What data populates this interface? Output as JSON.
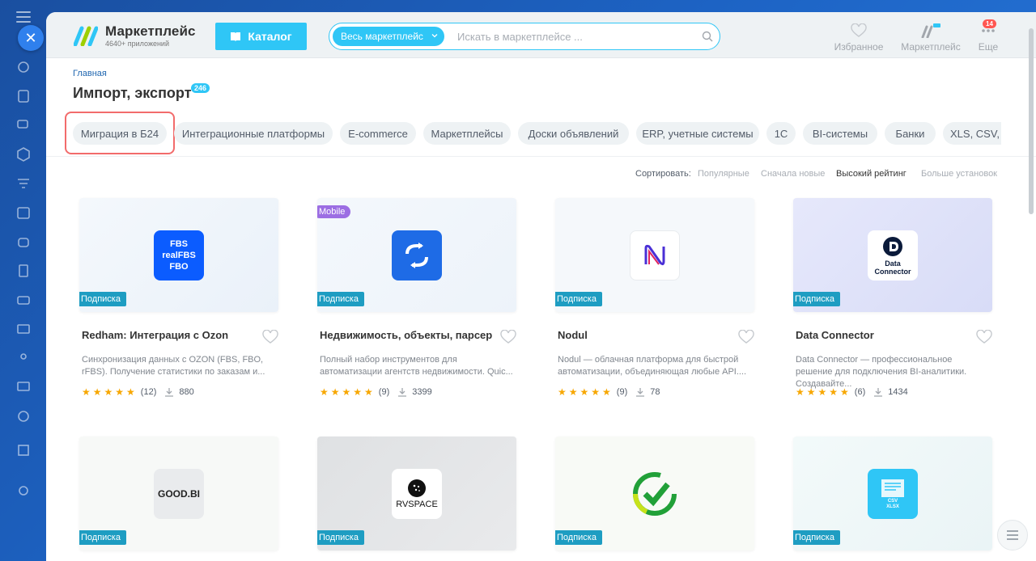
{
  "header": {
    "brand_title": "Маркетплейс",
    "brand_subtitle": "4640+ приложений",
    "catalog_label": "Каталог",
    "search_scope": "Весь маркетплейс",
    "search_placeholder": "Искать в маркетплейсе ...",
    "favorites_label": "Избранное",
    "marketplace_label": "Маркетплейс",
    "more_label": "Еще",
    "more_badge": "14"
  },
  "breadcrumb": "Главная",
  "page_title": "Импорт, экспорт",
  "app_count": "246",
  "chips": [
    {
      "label": "Миграция в Б24"
    },
    {
      "label": "Интеграционные платформы"
    },
    {
      "label": "E-commerce"
    },
    {
      "label": "Маркетплейсы"
    },
    {
      "label": "Доски объявлений"
    },
    {
      "label": "ERP, учетные системы"
    },
    {
      "label": "1С"
    },
    {
      "label": "BI-системы"
    },
    {
      "label": "Банки"
    },
    {
      "label": "XLS, CSV, X"
    }
  ],
  "sort": {
    "label": "Сортировать:",
    "options": [
      "Популярные",
      "Сначала новые",
      "Высокий рейтинг",
      "Больше установок"
    ],
    "active": "Высокий рейтинг"
  },
  "subscription_tag": "Подписка",
  "mobile_tag": "Mobile",
  "apps": [
    {
      "title": "Redham: Интеграция с Ozon",
      "desc": "Синхронизация данных с OZON (FBS, FBO, rFBS). Получение статистики по заказам и...",
      "reviews": "(12)",
      "installs": "880",
      "rating": 5,
      "icon": "fbs-icon",
      "icon_text": [
        "FBS",
        "realFBS",
        "FBO"
      ]
    },
    {
      "title": "Недвижимость, объекты, парсер",
      "desc": "Полный набор инструментов для автоматизации агентств недвижимости. Quic...",
      "reviews": "(9)",
      "installs": "3399",
      "rating": 5,
      "icon": "sync-arrows-icon",
      "mobile": true
    },
    {
      "title": "Nodul",
      "desc": "Nodul — облачная платформа для быстрой автоматизации, объединяющая любые API....",
      "reviews": "(9)",
      "installs": "78",
      "rating": 5,
      "icon": "nodul-logo-icon"
    },
    {
      "title": "Data Connector",
      "desc": "Data Connector — профессиональное решение для подключения BI-аналитики. Создавайте...",
      "reviews": "(6)",
      "installs": "1434",
      "rating": 5,
      "icon": "data-connector-icon",
      "icon_text": [
        "Data",
        "Connector"
      ]
    },
    {
      "title": "",
      "icon": "goodbi-logo-icon",
      "icon_text": [
        "GOOD.BI"
      ]
    },
    {
      "title": "",
      "icon": "rvspace-logo-icon",
      "icon_text": [
        "RVSPACE"
      ]
    },
    {
      "title": "",
      "icon": "checkmark-logo-icon"
    },
    {
      "title": "",
      "icon": "csv-xlsx-file-icon",
      "icon_text": [
        "CSV",
        "XLSX"
      ]
    }
  ]
}
